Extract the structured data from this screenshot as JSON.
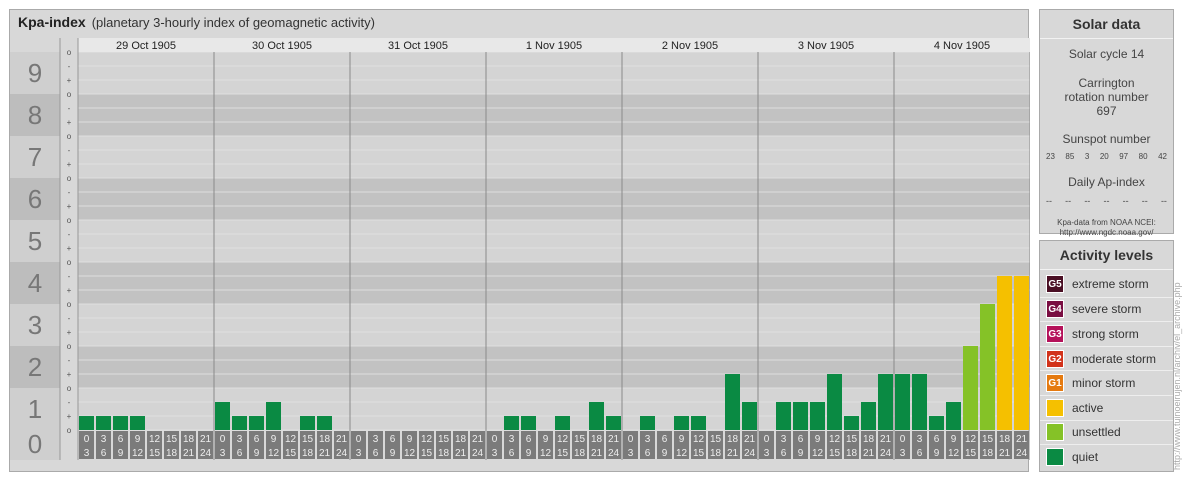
{
  "header": {
    "title": "Kpa-index",
    "subtitle": "(planetary 3-hourly index of geomagnetic activity)"
  },
  "chart_data": {
    "type": "bar",
    "title": "Kpa-index",
    "subtitle": "(planetary 3-hourly index of geomagnetic activity)",
    "ylim": [
      0,
      9
    ],
    "major_ticks": [
      "0",
      "1",
      "2",
      "3",
      "4",
      "5",
      "6",
      "7",
      "8",
      "9"
    ],
    "minor_ticks": [
      "o",
      "+",
      "-"
    ],
    "days": [
      "29 Oct 1905",
      "30 Oct 1905",
      "31 Oct 1905",
      "1 Nov 1905",
      "2 Nov 1905",
      "3 Nov 1905",
      "4 Nov 1905"
    ],
    "hour_top": [
      "0",
      "3",
      "6",
      "9",
      "12",
      "15",
      "18",
      "21"
    ],
    "hour_bottom": [
      "3",
      "6",
      "9",
      "12",
      "15",
      "18",
      "21",
      "24"
    ],
    "values": [
      [
        0.333,
        0.333,
        0.333,
        0.333,
        0.0,
        0.0,
        0.0,
        0.0
      ],
      [
        0.667,
        0.333,
        0.333,
        0.667,
        0.0,
        0.333,
        0.333,
        0.0
      ],
      [
        0.0,
        0.0,
        0.0,
        0.0,
        0.0,
        0.0,
        0.0,
        0.0
      ],
      [
        0.0,
        0.333,
        0.333,
        0.0,
        0.333,
        0.0,
        0.667,
        0.333
      ],
      [
        0.0,
        0.333,
        0.0,
        0.333,
        0.333,
        0.0,
        1.333,
        0.667
      ],
      [
        0.0,
        0.667,
        0.667,
        0.667,
        1.333,
        0.333,
        0.667,
        1.333
      ],
      [
        1.333,
        1.333,
        0.333,
        0.667,
        2.0,
        3.0,
        3.667,
        3.667
      ]
    ],
    "grid": true
  },
  "solar": {
    "header": "Solar data",
    "cycle": "Solar cycle 14",
    "carrington": "Carrington rotation number 697",
    "sunspot_label": "Sunspot number",
    "sunspots": [
      "23",
      "85",
      "3",
      "20",
      "97",
      "80",
      "42"
    ],
    "ap_label": "Daily Ap-index",
    "ap_values": [
      "--",
      "--",
      "--",
      "--",
      "--",
      "--",
      "--"
    ],
    "credit_line1": "Kpa-data from NOAA NCEI:",
    "credit_line2": "http://www.ngdc.noaa.gov/"
  },
  "activity": {
    "header": "Activity levels",
    "levels": [
      {
        "code": "G5",
        "label": "extreme storm",
        "color": "#4a0f24"
      },
      {
        "code": "G4",
        "label": "severe storm",
        "color": "#7a0e42"
      },
      {
        "code": "G3",
        "label": "strong storm",
        "color": "#b5125a"
      },
      {
        "code": "G2",
        "label": "moderate storm",
        "color": "#d2321a"
      },
      {
        "code": "G1",
        "label": "minor storm",
        "color": "#e57a10"
      },
      {
        "code": "",
        "label": "active",
        "color": "#f5c000"
      },
      {
        "code": "",
        "label": "unsettled",
        "color": "#85c227"
      },
      {
        "code": "",
        "label": "quiet",
        "color": "#0a8a43"
      }
    ]
  },
  "side_credit": "http://www.tuinoeirujen.nl/archiv/el_archive.php"
}
